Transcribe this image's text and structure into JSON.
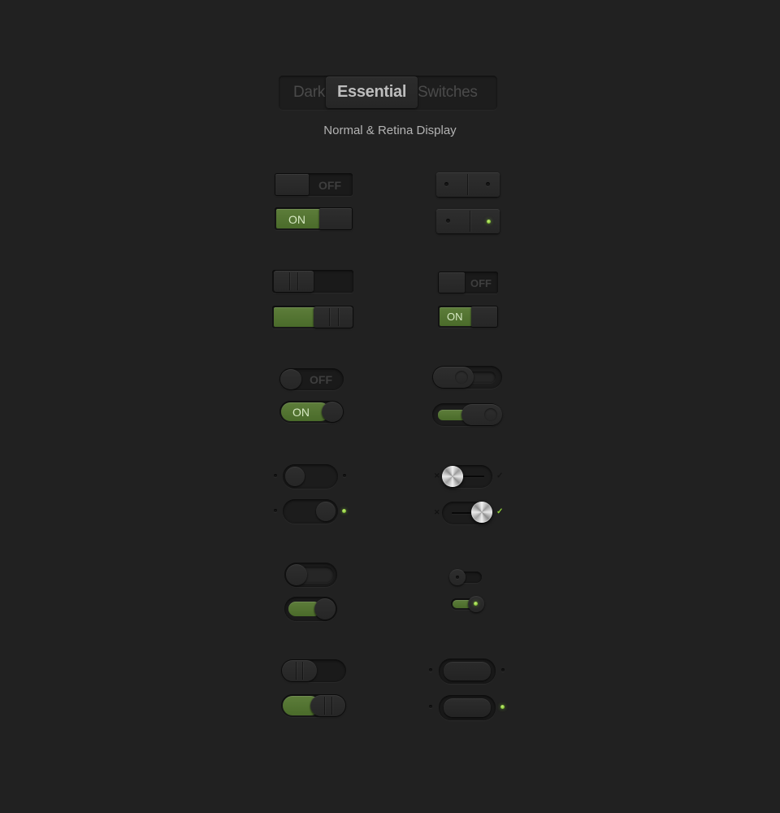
{
  "header": {
    "title_left": "Dark",
    "title_center": "Essential",
    "title_right": "Switches",
    "subtitle": "Normal & Retina Display"
  },
  "colors": {
    "background": "#212121",
    "accent_green": "#557532",
    "indicator_lit": "#8fd03a"
  },
  "switches": {
    "row1_left": {
      "style": "square-labeled",
      "off_label": "OFF",
      "on_label": "ON"
    },
    "row1_right": {
      "style": "square-dot-indicator",
      "off_state": "off",
      "on_state": "on"
    },
    "row2_left": {
      "style": "square-grip",
      "off_state": "off",
      "on_state": "on"
    },
    "row2_right": {
      "style": "square-labeled-small",
      "off_label": "OFF",
      "on_label": "ON"
    },
    "row3_left": {
      "style": "rounded-labeled",
      "off_label": "OFF",
      "on_label": "ON"
    },
    "row3_right": {
      "style": "rounded-knob-slider",
      "off_state": "off",
      "on_state": "on"
    },
    "row4_left": {
      "style": "pill-led",
      "off_state": "off",
      "on_state": "on"
    },
    "row4_right": {
      "style": "metal-knob",
      "off_icon": "x-icon",
      "on_icon": "check-icon"
    },
    "row5_left": {
      "style": "round-knob",
      "off_state": "off",
      "on_state": "on"
    },
    "row5_right": {
      "style": "mini-round-knob",
      "off_state": "off",
      "on_state": "on"
    },
    "row6_left": {
      "style": "pill-grip",
      "off_state": "off",
      "on_state": "on"
    },
    "row6_right": {
      "style": "rocker-led",
      "off_state": "off",
      "on_state": "on"
    }
  }
}
